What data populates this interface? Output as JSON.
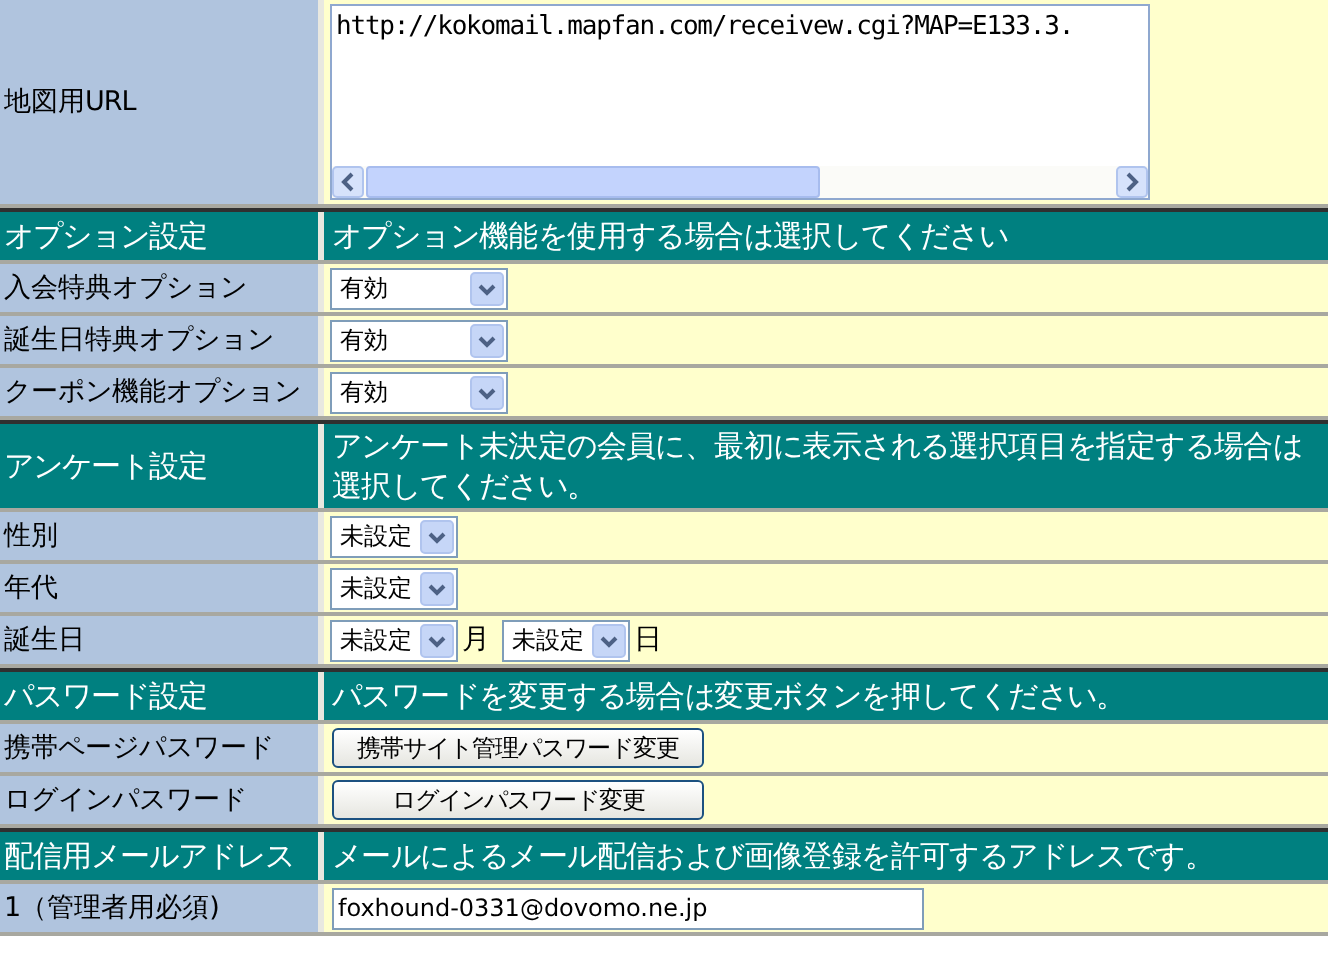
{
  "rows": [
    {
      "kind": "textarea",
      "label": "地図用URL",
      "value": "http://kokomail.mapfan.com/receivew.cgi?MAP=E133.3."
    },
    {
      "kind": "header",
      "label": "オプション設定",
      "description": "オプション機能を使用する場合は選択してください"
    },
    {
      "kind": "option",
      "label": "入会特典オプション",
      "value": "有効"
    },
    {
      "kind": "option",
      "label": "誕生日特典オプション",
      "value": "有効"
    },
    {
      "kind": "option",
      "label": "クーポン機能オプション",
      "value": "有効"
    },
    {
      "kind": "header",
      "label": "アンケート設定",
      "description": "アンケート未決定の会員に、最初に表示される選択項目を指定する場合は選択してください。"
    },
    {
      "kind": "select",
      "label": "性別",
      "value": "未設定"
    },
    {
      "kind": "select",
      "label": "年代",
      "value": "未設定"
    },
    {
      "kind": "date",
      "label": "誕生日",
      "fields": [
        {
          "value": "未設定",
          "suffix": "月"
        },
        {
          "value": "未設定",
          "suffix": "日"
        }
      ]
    },
    {
      "kind": "header",
      "label": "パスワード設定",
      "description": "パスワードを変更する場合は変更ボタンを押してください。"
    },
    {
      "kind": "button",
      "label": "携帯ページパスワード",
      "button": "携帯サイト管理パスワード変更"
    },
    {
      "kind": "button",
      "label": "ログインパスワード",
      "button": "ログインパスワード変更"
    },
    {
      "kind": "header",
      "label": "配信用メールアドレス",
      "description": "メールによるメール配信および画像登録を許可するアドレスです。"
    },
    {
      "kind": "input",
      "label": "1（管理者用必須)",
      "value": "foxhound-0331@dovomo.ne.jp"
    }
  ]
}
